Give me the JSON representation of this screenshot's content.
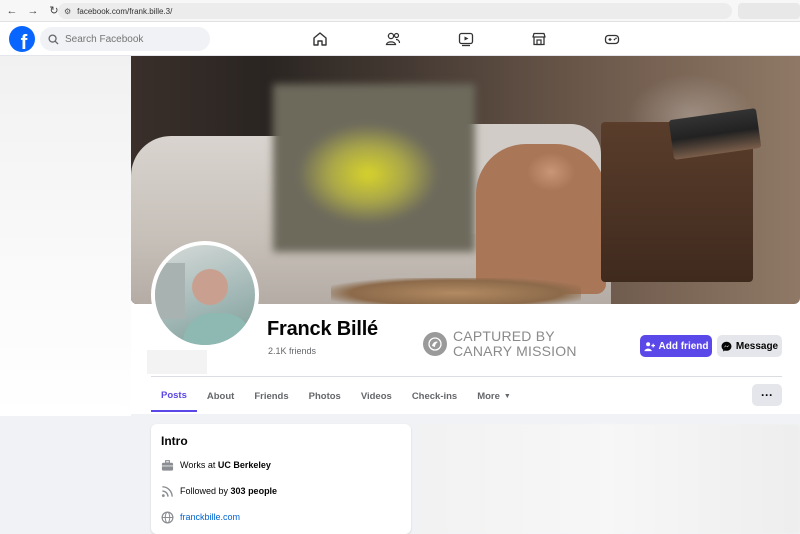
{
  "browser": {
    "url": "facebook.com/frank.bille.3/"
  },
  "topbar": {
    "logo_letter": "f",
    "search_placeholder": "Search Facebook",
    "nav_icons": [
      "home-icon",
      "friends-icon",
      "video-icon",
      "marketplace-icon",
      "gaming-icon"
    ]
  },
  "profile": {
    "name": "Franck Billé",
    "friends_count": "2.1K friends",
    "add_friend_label": "Add friend",
    "message_label": "Message"
  },
  "watermark": {
    "line1": "CAPTURED BY",
    "line2": "CANARY MISSION"
  },
  "tabs": [
    {
      "label": "Posts",
      "active": true
    },
    {
      "label": "About",
      "active": false
    },
    {
      "label": "Friends",
      "active": false
    },
    {
      "label": "Photos",
      "active": false
    },
    {
      "label": "Videos",
      "active": false
    },
    {
      "label": "Check-ins",
      "active": false
    },
    {
      "label": "More",
      "active": false
    }
  ],
  "more_button_label": "···",
  "intro": {
    "title": "Intro",
    "work_prefix": "Works at ",
    "work_place": "UC Berkeley",
    "followers_prefix": "Followed by ",
    "followers_count": "303 people",
    "website": "franckbille.com"
  },
  "colors": {
    "accent": "#5b48e8",
    "fb_blue": "#0866ff",
    "link": "#0064d1"
  }
}
